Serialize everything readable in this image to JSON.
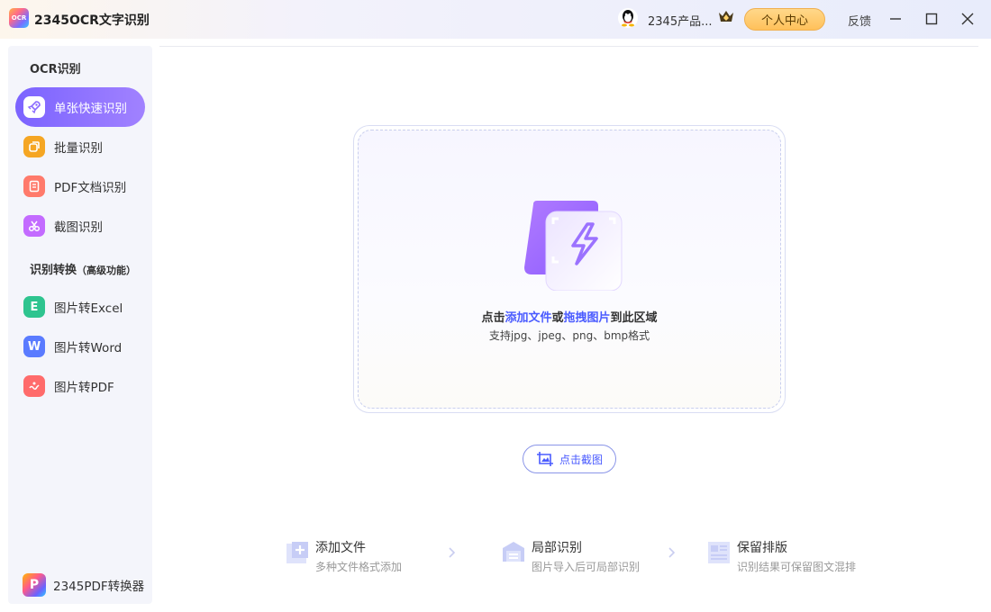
{
  "titlebar": {
    "logo_text": "OCR",
    "app_title": "2345OCR文字识别",
    "user_name": "2345产品...",
    "center_label": "个人中心",
    "feedback_label": "反馈"
  },
  "sidebar": {
    "section1_title": "OCR识别",
    "items1": [
      {
        "label": "单张快速识别",
        "color": "#8b6bff"
      },
      {
        "label": "批量识别",
        "color": "#f5a623"
      },
      {
        "label": "PDF文档识别",
        "color": "#ff7a6b"
      },
      {
        "label": "截图识别",
        "color": "#c36bff"
      }
    ],
    "section2_title": "识别转换",
    "section2_sub": "（高级功能）",
    "items2": [
      {
        "label": "图片转Excel",
        "color": "#2ec48f"
      },
      {
        "label": "图片转Word",
        "color": "#5a7bff"
      },
      {
        "label": "图片转PDF",
        "color": "#ff6b6b"
      }
    ],
    "promo_label": "2345PDF转换器"
  },
  "dropzone": {
    "text_prefix": "点击",
    "link1": "添加文件",
    "text_mid": "或",
    "link2": "拖拽图片",
    "text_suffix": "到此区域",
    "sub": "支持jpg、jpeg、png、bmp格式"
  },
  "screenshot_button": "点击截图",
  "features": [
    {
      "title": "添加文件",
      "desc": "多种文件格式添加"
    },
    {
      "title": "局部识别",
      "desc": "图片导入后可局部识别"
    },
    {
      "title": "保留排版",
      "desc": "识别结果可保留图文混排"
    }
  ],
  "colors": {
    "accent": "#7b63ff",
    "link": "#4a5bff",
    "gold": "#ffc15a"
  }
}
